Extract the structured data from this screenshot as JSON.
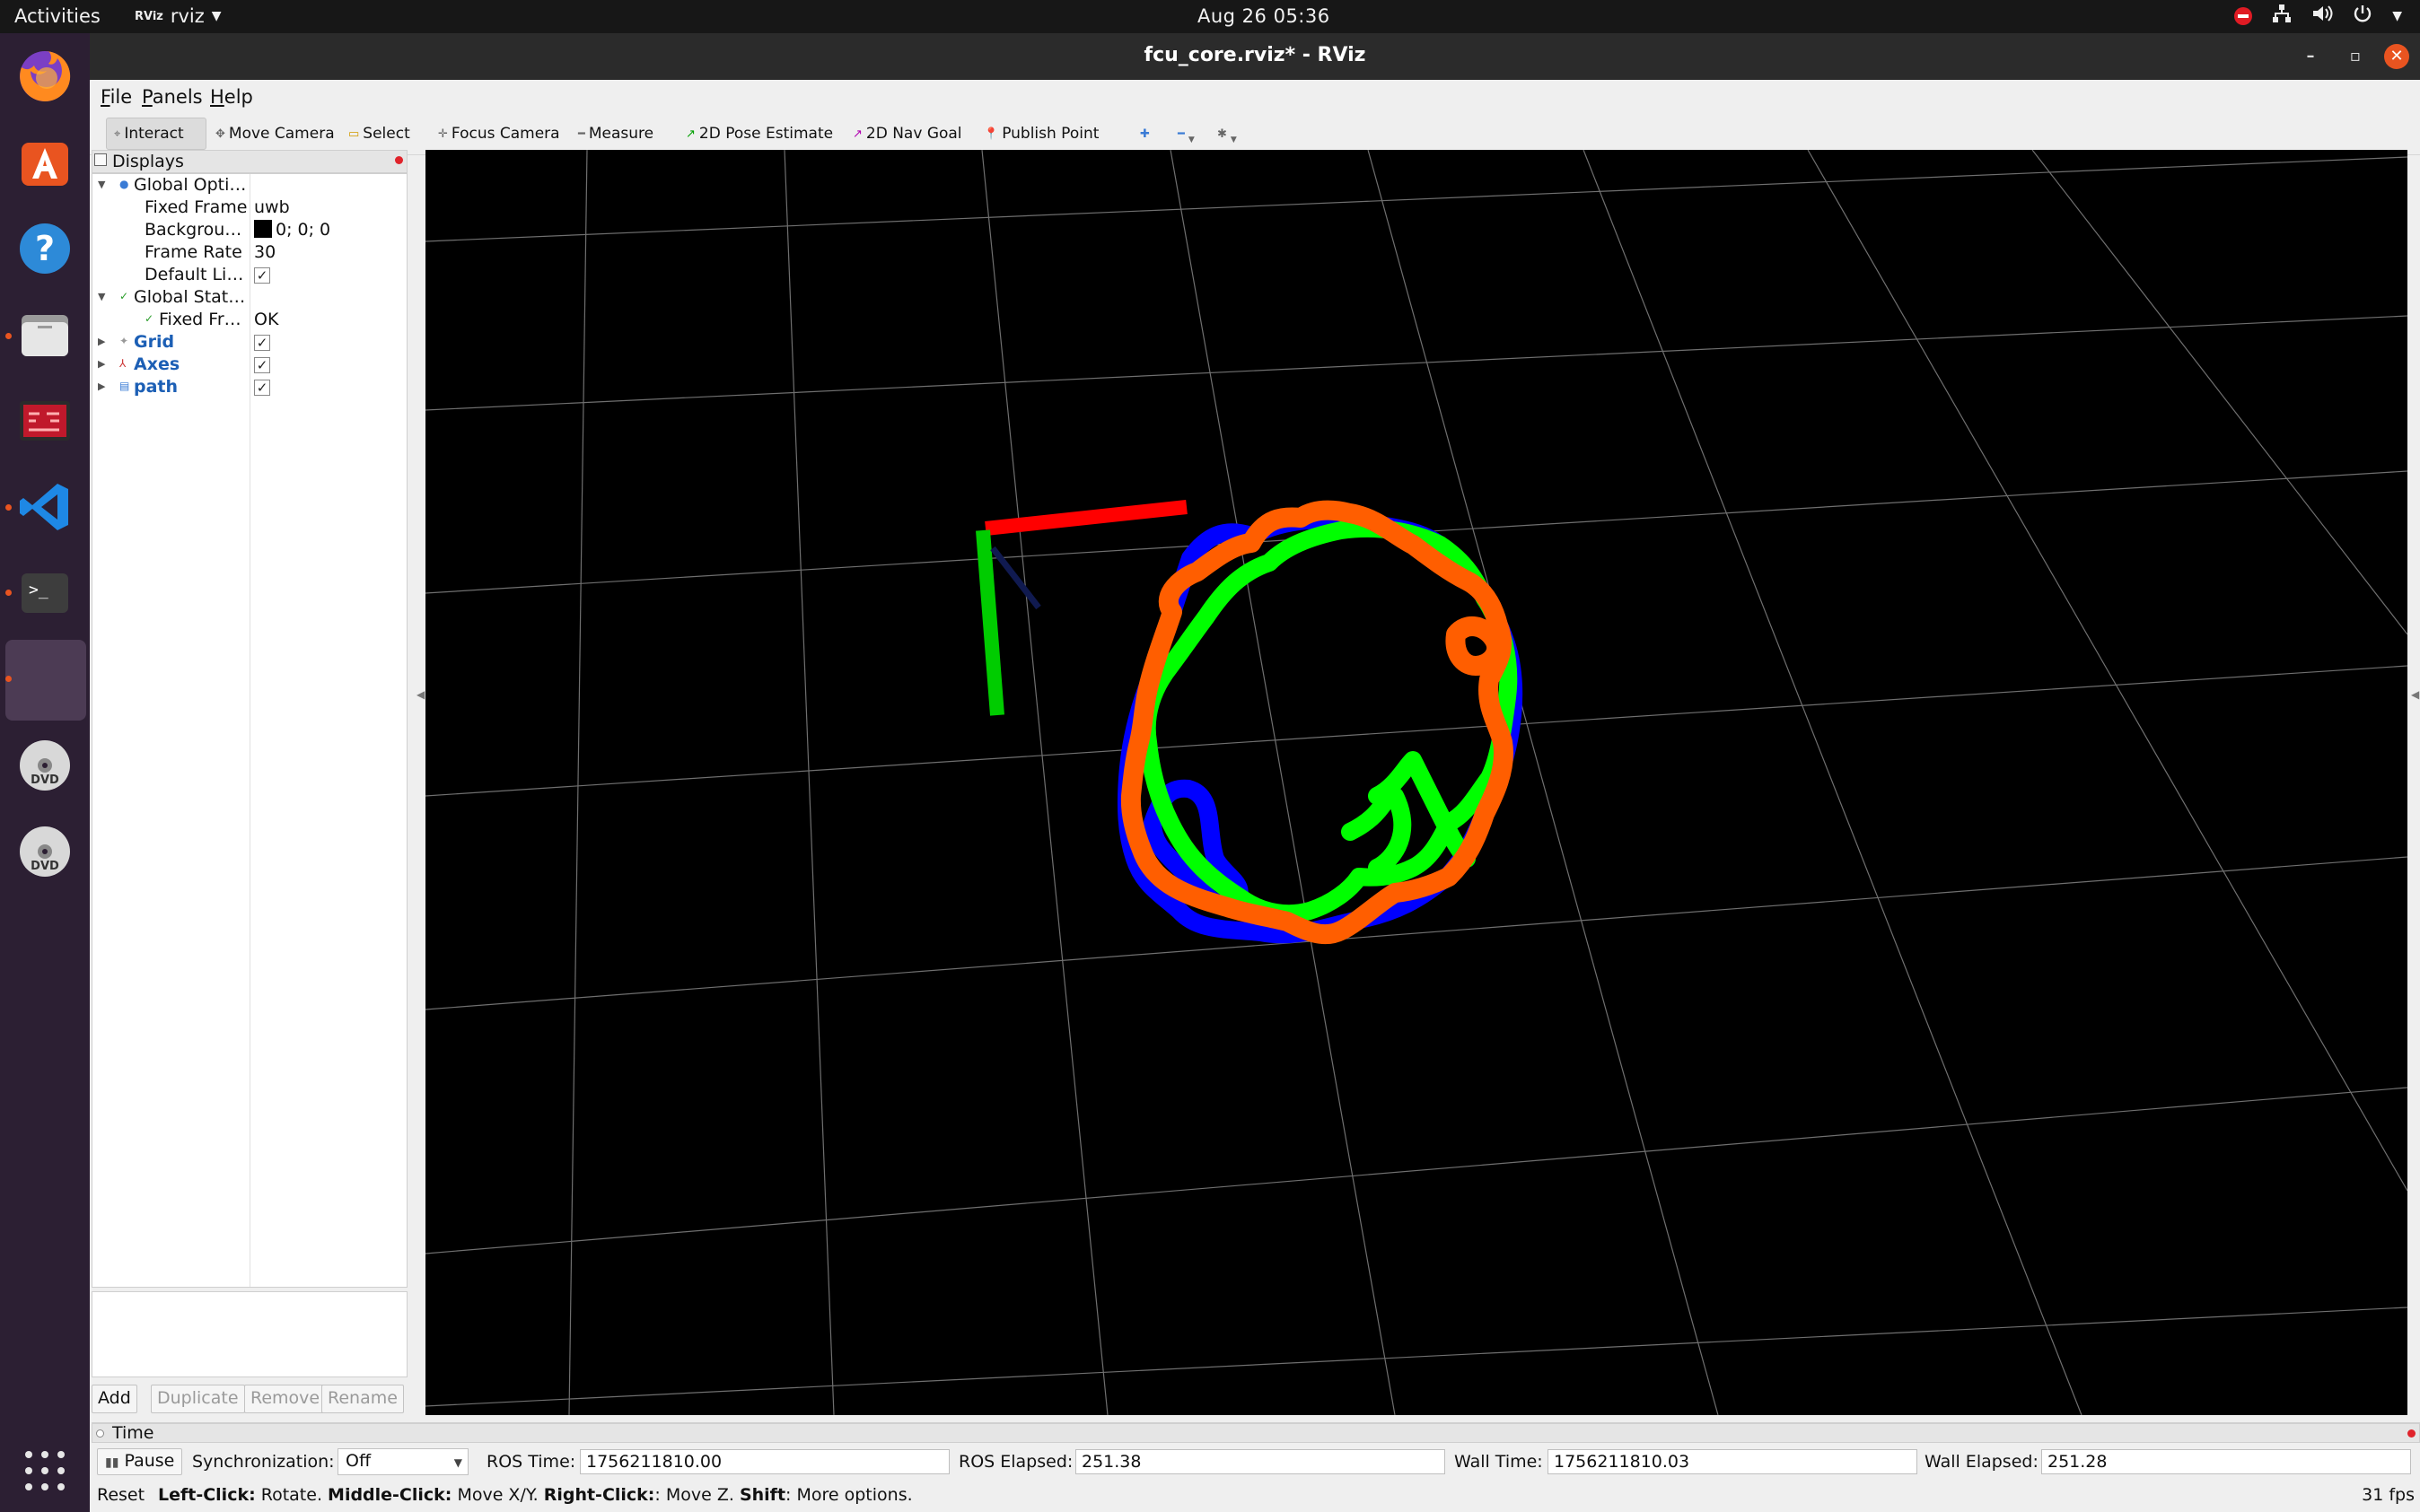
{
  "topbar": {
    "activities": "Activities",
    "app_name": "rviz",
    "app_icon_text": "RViz",
    "clock": "Aug 26  05:36"
  },
  "window": {
    "title": "fcu_core.rviz* - RViz"
  },
  "menu": [
    "File",
    "Panels",
    "Help"
  ],
  "toolbar": {
    "interact": "Interact",
    "move_camera": "Move Camera",
    "select": "Select",
    "focus_camera": "Focus Camera",
    "measure": "Measure",
    "pose_estimate": "2D Pose Estimate",
    "nav_goal": "2D Nav Goal",
    "publish_point": "Publish Point"
  },
  "displays": {
    "title": "Displays",
    "rows": {
      "global_options": "Global Opti…",
      "fixed_frame_label": "Fixed Frame",
      "fixed_frame_value": "uwb",
      "background_label": "Backgrou…",
      "background_value": "0; 0; 0",
      "frame_rate_label": "Frame Rate",
      "frame_rate_value": "30",
      "default_light_label": "Default Li…",
      "global_status": "Global Stat…",
      "fixed_frame_status_label": "Fixed Fr…",
      "fixed_frame_status_value": "OK",
      "grid": "Grid",
      "axes": "Axes",
      "path": "path"
    },
    "check_mark": "✓",
    "buttons": {
      "add": "Add",
      "duplicate": "Duplicate",
      "remove": "Remove",
      "rename": "Rename"
    }
  },
  "time": {
    "title": "Time",
    "pause": "Pause",
    "sync_label": "Synchronization:",
    "sync_value": "Off",
    "ros_time_label": "ROS Time:",
    "ros_time_value": "1756211810.00",
    "ros_elapsed_label": "ROS Elapsed:",
    "ros_elapsed_value": "251.38",
    "wall_time_label": "Wall Time:",
    "wall_time_value": "1756211810.03",
    "wall_elapsed_label": "Wall Elapsed:",
    "wall_elapsed_value": "251.28"
  },
  "status": {
    "reset": "Reset",
    "left_click": "Left-Click:",
    "left_click_desc": " Rotate. ",
    "middle_click": "Middle-Click:",
    "middle_click_desc": " Move X/Y. ",
    "right_click": "Right-Click:",
    "right_click_desc": ": Move Z. ",
    "shift": "Shift",
    "shift_desc": ": More options.",
    "fps": "31 fps"
  },
  "colors": {
    "axis_x": "#ff0000",
    "axis_y": "#00cc00",
    "path_blue": "#0000ff",
    "path_green": "#00ff00",
    "path_orange": "#ff5e00",
    "grid_line": "#8a8a8a",
    "background": "#000000",
    "ubuntu_orange": "#e95420"
  },
  "dock_icons": [
    "firefox-icon",
    "app-center-icon",
    "help-icon",
    "files-icon",
    "rviz-icon",
    "vscode-icon",
    "terminal-icon",
    "active-window",
    "dvd-icon",
    "dvd-icon",
    "show-apps-icon"
  ]
}
